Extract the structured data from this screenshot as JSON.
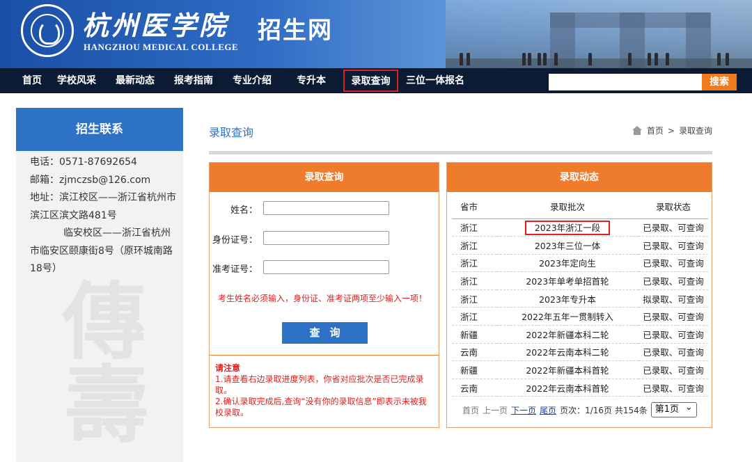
{
  "header": {
    "school_name": "杭州医学院",
    "school_en": "HANGZHOU MEDICAL COLLEGE",
    "site_name": "招生网"
  },
  "nav": {
    "items": [
      {
        "label": "首页"
      },
      {
        "label": "学校风采"
      },
      {
        "label": "最新动态"
      },
      {
        "label": "报考指南"
      },
      {
        "label": "专业介绍"
      },
      {
        "label": "专升本"
      },
      {
        "label": "录取查询",
        "active": true
      },
      {
        "label": "三位一体报名"
      }
    ],
    "search_button": "搜索"
  },
  "sidebar": {
    "title": "招生联系",
    "phone": "电话：0571-87692654",
    "email": "邮箱：zjmczsb@126.com",
    "address_1": "地址：滨江校区——浙江省杭州市",
    "address_2": "滨江区滨文路481号",
    "address_3": "临安校区——浙江省杭州",
    "address_4": "市临安区颐康街8号（原环城南路",
    "address_5": "18号）"
  },
  "main": {
    "page_title": "录取查询",
    "breadcrumb_home": "首页",
    "breadcrumb_sep": ">",
    "breadcrumb_current": "录取查询"
  },
  "query_panel": {
    "title": "录取查询",
    "name_label": "姓名：",
    "id_label": "身份证号：",
    "exam_label": "准考证号：",
    "warning": "考生姓名必须输入，身份证、准考证两项至少输入一项！",
    "query_button": "查询",
    "notice_title": "请注意",
    "notice_1": "1.请查看右边录取进度列表，你省对应批次是否已完成录取。",
    "notice_2": "2.确认录取完成后,查询“没有你的录取信息”即表示未被我校录取。"
  },
  "status_panel": {
    "title": "录取动态",
    "columns": [
      "省市",
      "录取批次",
      "录取状态"
    ],
    "rows": [
      [
        "浙江",
        "2023年浙江一段",
        "已录取、可查询"
      ],
      [
        "浙江",
        "2023年三位一体",
        "已录取、可查询"
      ],
      [
        "浙江",
        "2023年定向生",
        "已录取、可查询"
      ],
      [
        "浙江",
        "2023年单考单招首轮",
        "已录取、可查询"
      ],
      [
        "浙江",
        "2023年专升本",
        "拟录取、可查询"
      ],
      [
        "浙江",
        "2022年五年一贯制转入",
        "已录取、可查询"
      ],
      [
        "新疆",
        "2022年新疆本科二轮",
        "已录取、可查询"
      ],
      [
        "云南",
        "2022年云南本科二轮",
        "已录取、可查询"
      ],
      [
        "新疆",
        "2022年新疆本科首轮",
        "已录取、可查询"
      ],
      [
        "云南",
        "2022年云南本科首轮",
        "已录取、可查询"
      ]
    ],
    "pager": {
      "first": "首页",
      "prev": "上一页",
      "next": "下一页",
      "last": "尾页",
      "info": "页次：1/16页 共154条",
      "select_value": "第1页"
    }
  },
  "colors": {
    "nav_bg": "#0b1b33",
    "primary_blue": "#2d72c4",
    "accent_orange": "#ef7c2c",
    "warning_red": "#e02020"
  }
}
